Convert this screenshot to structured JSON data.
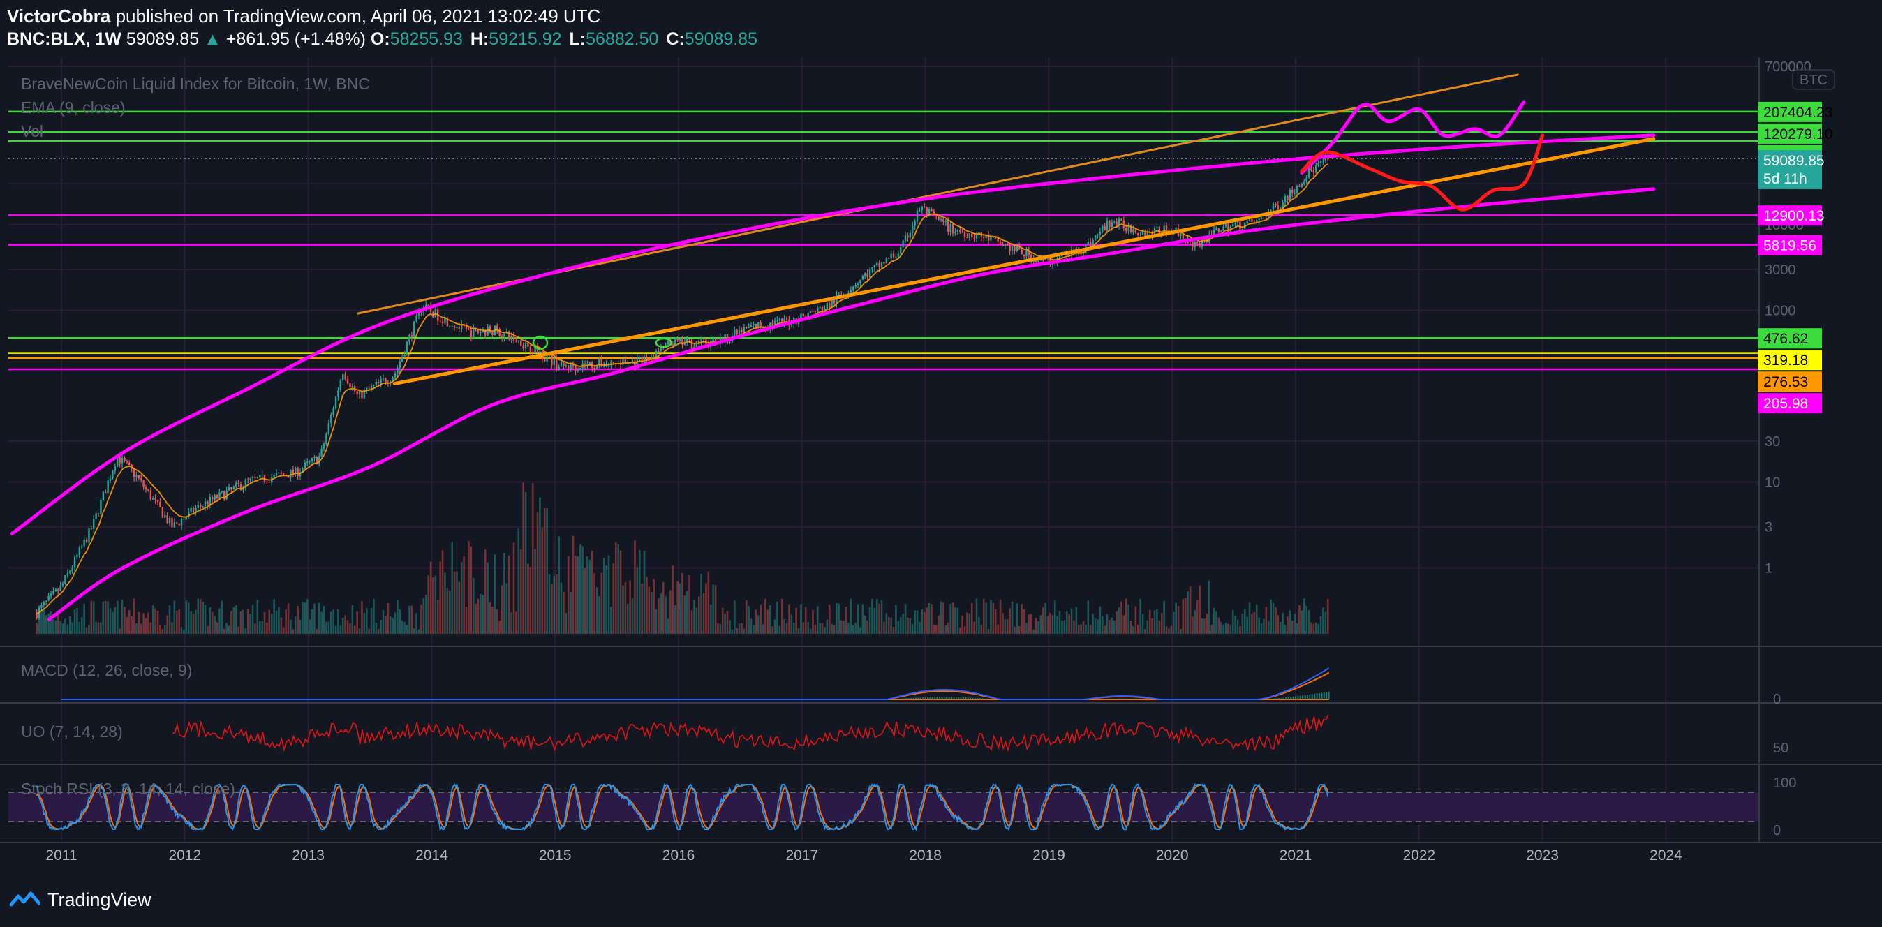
{
  "header": {
    "author": "VictorCobra",
    "published": "published on TradingView.com, April 06, 2021 13:02:49 UTC",
    "symbol": "BNC:BLX, 1W",
    "price": "59089.85",
    "change": "+861.95 (+1.48%)",
    "open_label": "O:",
    "open": "58255.93",
    "high_label": "H:",
    "high": "59215.92",
    "low_label": "L:",
    "low": "56882.50",
    "close_label": "C:",
    "close": "59089.85"
  },
  "panes": {
    "main_title": "BraveNewCoin Liquid Index for Bitcoin, 1W, BNC",
    "ema_label": "EMA (9, close)",
    "vol_label": "Vol",
    "macd_label": "MACD (12, 26, close, 9)",
    "uo_label": "UO (7, 14, 28)",
    "stoch_label": "Stoch RSI (3, 3, 14, 14, close)",
    "currency_badge": "BTC"
  },
  "colors": {
    "background": "#131722",
    "grid": "#2a1d36",
    "magenta": "#ff00ff",
    "orange": "#ff9800",
    "orange_thin": "#e08a1e",
    "green": "#3cdc3c",
    "yellow": "#ffff00",
    "red": "#ff1a1a",
    "teal": "#26a69a",
    "candle_up": "#26a69a",
    "candle_down": "#ef5350",
    "macd_line": "#2962ff",
    "signal_line": "#ff6d00",
    "uo_line": "#e01414",
    "stoch_k": "#2196f3",
    "stoch_d": "#ff6d00",
    "stoch_band": "#2a1a45"
  },
  "chart_data": {
    "type": "line",
    "title": "BraveNewCoin Liquid Index for Bitcoin, 1W, BNC",
    "scale": "log",
    "y_axis_ticks": [
      "700000",
      "30000",
      "10000",
      "3000",
      "1000",
      "30",
      "10",
      "3",
      "1"
    ],
    "x_axis_ticks": [
      "2011",
      "2012",
      "2013",
      "2014",
      "2015",
      "2016",
      "2017",
      "2018",
      "2019",
      "2020",
      "2021",
      "2022",
      "2023",
      "2024"
    ],
    "price_series": {
      "name": "BNC:BLX close (approx.)",
      "x": [
        2010.8,
        2011.0,
        2011.25,
        2011.45,
        2011.6,
        2011.9,
        2012.1,
        2012.5,
        2012.9,
        2013.1,
        2013.28,
        2013.4,
        2013.7,
        2013.92,
        2014.1,
        2014.3,
        2014.5,
        2014.8,
        2015.05,
        2015.4,
        2015.7,
        2015.95,
        2016.3,
        2016.6,
        2016.9,
        2017.2,
        2017.5,
        2017.8,
        2017.96,
        2018.2,
        2018.5,
        2018.9,
        2019.0,
        2019.3,
        2019.5,
        2019.8,
        2020.0,
        2020.2,
        2020.4,
        2020.7,
        2020.95,
        2021.1,
        2021.27
      ],
      "y": [
        0.3,
        0.6,
        3,
        20,
        12,
        3,
        5,
        10,
        13,
        20,
        200,
        100,
        180,
        1100,
        800,
        550,
        600,
        380,
        220,
        240,
        250,
        420,
        420,
        650,
        750,
        1100,
        2500,
        5000,
        16000,
        9000,
        7000,
        4000,
        3700,
        5500,
        11000,
        8000,
        9000,
        5500,
        9300,
        10800,
        23000,
        40000,
        59089.85
      ]
    },
    "drawings": {
      "channel_upper_thin_orange": {
        "x": [
          2013.4,
          2022.8
        ],
        "y": [
          920,
          560000
        ]
      },
      "support_orange": {
        "x": [
          2013.7,
          2023.9
        ],
        "y": [
          140,
          100000
        ]
      },
      "curve_upper_magenta": {
        "x": [
          2010.6,
          2011.5,
          2012.5,
          2013.6,
          2015.0,
          2016.5,
          2018.0,
          2019.5,
          2021.0,
          2022.5,
          2023.9
        ],
        "y": [
          2.5,
          22,
          120,
          700,
          2800,
          8500,
          20000,
          36000,
          58000,
          84000,
          110000
        ]
      },
      "curve_lower_magenta": {
        "x": [
          2010.9,
          2011.5,
          2012.5,
          2013.5,
          2014.5,
          2015.5,
          2016.5,
          2017.5,
          2018.5,
          2019.5,
          2020.5,
          2021.5,
          2022.5,
          2023.9
        ],
        "y": [
          0.25,
          1.0,
          4.5,
          15,
          80,
          190,
          500,
          1200,
          2700,
          4600,
          8000,
          12000,
          17000,
          26000
        ]
      },
      "projection_magenta": {
        "x": [
          2021.05,
          2021.3,
          2021.55,
          2021.75,
          2022.0,
          2022.2,
          2022.45,
          2022.65,
          2022.85
        ],
        "y": [
          40000,
          90000,
          250000,
          160000,
          220000,
          110000,
          130000,
          110000,
          270000
        ]
      },
      "projection_red": {
        "x": [
          2021.05,
          2021.25,
          2021.6,
          2021.85,
          2022.1,
          2022.35,
          2022.6,
          2022.85,
          2023.0
        ],
        "y": [
          42000,
          70000,
          45000,
          32000,
          28000,
          15000,
          25000,
          30000,
          110000
        ]
      }
    },
    "horizontal_levels": [
      {
        "label": "207404.23",
        "value": 207404.23,
        "color": "#3cdc3c"
      },
      {
        "label": "120279.10",
        "value": 120279.1,
        "color": "#3cdc3c"
      },
      {
        "label": "93892.79",
        "value": 93892.79,
        "color": "#3cdc3c"
      },
      {
        "label": "12900.13",
        "value": 12900.13,
        "color": "#ff00ff"
      },
      {
        "label": "5819.56",
        "value": 5819.56,
        "color": "#ff00ff"
      },
      {
        "label": "476.62",
        "value": 476.62,
        "color": "#3cdc3c"
      },
      {
        "label": "319.18",
        "value": 319.18,
        "color": "#ffff00"
      },
      {
        "label": "276.53",
        "value": 276.53,
        "color": "#ff9800"
      },
      {
        "label": "205.98",
        "value": 205.98,
        "color": "#ff00ff"
      }
    ],
    "last_price_label": "59089.85",
    "countdown_label": "5d 11h",
    "macd_ticks": [
      "0"
    ],
    "uo_ticks": [
      "50"
    ],
    "stoch_ticks": [
      "100",
      "0"
    ]
  },
  "footer": {
    "brand": "TradingView"
  }
}
